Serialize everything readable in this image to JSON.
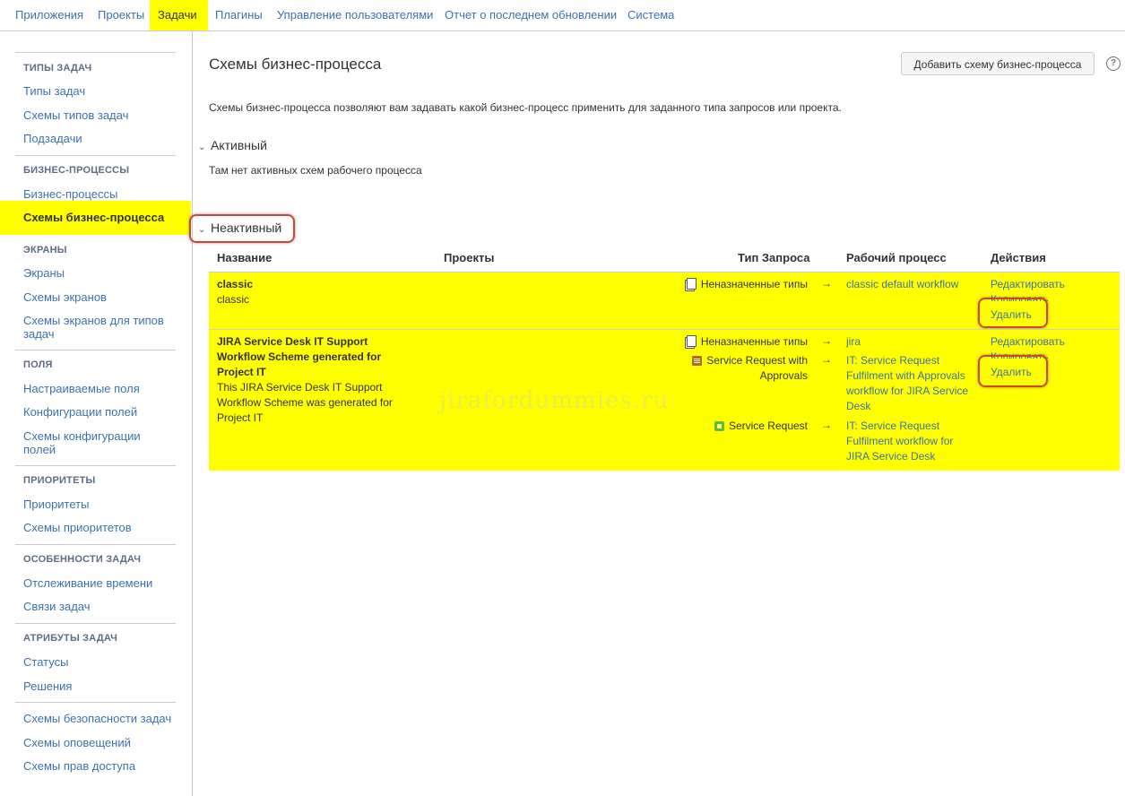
{
  "nav": {
    "tabs": [
      "Приложения",
      "Проекты",
      "Задачи",
      "Плагины",
      "Управление пользователями",
      "Отчет о последнем обновлении",
      "Система"
    ]
  },
  "sidebar": {
    "sections": [
      {
        "header": "ТИПЫ ЗАДАЧ",
        "items": [
          "Типы задач",
          "Схемы типов задач",
          "Подзадачи"
        ]
      },
      {
        "header": "БИЗНЕС-ПРОЦЕССЫ",
        "items": [
          "Бизнес-процессы",
          "Схемы бизнес-процесса"
        ]
      },
      {
        "header": "ЭКРАНЫ",
        "items": [
          "Экраны",
          "Схемы экранов",
          "Схемы экранов для типов задач"
        ]
      },
      {
        "header": "ПОЛЯ",
        "items": [
          "Настраиваемые поля",
          "Конфигурации полей",
          "Схемы конфигурации полей"
        ]
      },
      {
        "header": "ПРИОРИТЕТЫ",
        "items": [
          "Приоритеты",
          "Схемы приоритетов"
        ]
      },
      {
        "header": "ОСОБЕННОСТИ ЗАДАЧ",
        "items": [
          "Отслеживание времени",
          "Связи задач"
        ]
      },
      {
        "header": "АТРИБУТЫ ЗАДАЧ",
        "items": [
          "Статусы",
          "Решения"
        ]
      },
      {
        "header": "",
        "items": [
          "Схемы безопасности задач",
          "Схемы оповещений",
          "Схемы прав доступа"
        ]
      }
    ]
  },
  "main": {
    "title": "Схемы бизнес-процесса",
    "add_button": "Добавить схему бизнес-процесса",
    "help_icon": "?",
    "description": "Схемы бизнес-процесса позволяют вам задавать какой бизнес-процесс применить для заданного типа запросов или проекта.",
    "active": {
      "label": "Активный",
      "empty_text": "Там нет активных схем рабочего процесса"
    },
    "inactive": {
      "label": "Неактивный"
    },
    "table": {
      "headers": [
        "Название",
        "Проекты",
        "Тип Запроса",
        "Рабочий процесс",
        "Действия"
      ],
      "rows": [
        {
          "name": "classic",
          "description": "classic",
          "mappings": [
            {
              "issue_type": "Неназначенные типы",
              "icon": "unassigned-types-icon",
              "arrow": "→",
              "workflow": "classic default workflow"
            }
          ],
          "actions": [
            "Редактировать",
            "Копировать",
            "Удалить"
          ]
        },
        {
          "name": "JIRA Service Desk IT Support Workflow Scheme generated for Project IT",
          "description": "This JIRA Service Desk IT Support Workflow Scheme was generated for Project IT",
          "mappings": [
            {
              "issue_type": "Неназначенные типы",
              "icon": "unassigned-types-icon",
              "arrow": "→",
              "workflow": "jira"
            },
            {
              "issue_type": "Service Request with Approvals",
              "icon": "approval-request-icon",
              "arrow": "→",
              "workflow": "IT: Service Request Fulfilment with Approvals workflow for JIRA Service Desk"
            },
            {
              "issue_type": "Service Request",
              "icon": "service-request-icon",
              "arrow": "→",
              "workflow": "IT: Service Request Fulfilment workflow for JIRA Service Desk"
            }
          ],
          "actions": [
            "Редактировать",
            "Копировать",
            "Удалить"
          ]
        }
      ]
    },
    "watermark": "jirafordummies.ru"
  },
  "colors": {
    "highlight": "#ffff00",
    "link": "#3b73af",
    "outline": "#d04437"
  }
}
